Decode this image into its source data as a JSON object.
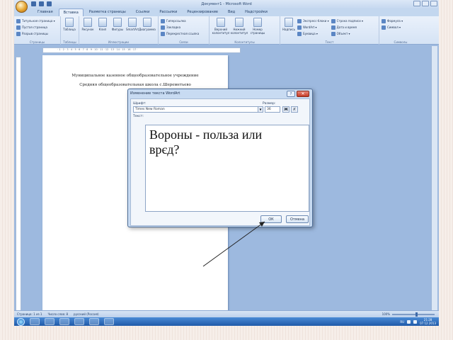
{
  "window": {
    "title": "Документ1 - Microsoft Word"
  },
  "ribbon_tabs": [
    "Главная",
    "Вставка",
    "Разметка страницы",
    "Ссылки",
    "Рассылки",
    "Рецензирование",
    "Вид",
    "Надстройки"
  ],
  "ribbon": {
    "pages_group": {
      "items": [
        "Титульная страница ▾",
        "Пустая страница",
        "Разрыв страницы"
      ],
      "label": "Страницы"
    },
    "tables_group": {
      "button": "Таблица",
      "label": "Таблицы"
    },
    "illustrations_group": {
      "buttons": [
        "Рисунок",
        "Клип",
        "Фигуры",
        "SmartArt",
        "Диаграмма"
      ],
      "label": "Иллюстрации"
    },
    "links_group": {
      "items": [
        "Гиперссылка",
        "Закладка",
        "Перекрестная ссылка"
      ],
      "label": "Связи"
    },
    "header_group": {
      "buttons": [
        "Верхний колонтитул",
        "Нижний колонтитул",
        "Номер страницы"
      ],
      "label": "Колонтитулы"
    },
    "text_group": {
      "button": "Надпись",
      "items": [
        "Экспресс-блоки ▾",
        "WordArt ▾",
        "Буквица ▾",
        "Строка подписи ▾",
        "Дата и время",
        "Объект ▾"
      ],
      "label": "Текст"
    },
    "symbols_group": {
      "items": [
        "Формула ▾",
        "Символ ▾"
      ],
      "label": "Символы"
    }
  },
  "document": {
    "lines": [
      "Муниципальное казенное общеобразовательное учреждение",
      "Средняя общеобразовательная школа с.Шереметьево"
    ]
  },
  "dialog": {
    "title": "Изменение текста WordArt",
    "help": "?",
    "close": "✕",
    "font_label": "Шрифт:",
    "font_value": "Times New Roman",
    "size_label": "Размер:",
    "size_value": "36",
    "bold": "Ж",
    "italic": "К",
    "text_label": "Текст:",
    "text_value": "Вороны - польза или\nврєд?",
    "ok_label": "ОК",
    "cancel_label": "Отмена"
  },
  "statusbar": {
    "page": "Страница: 1 из 1",
    "words": "Число слов: 8",
    "language": "русский (Россия)",
    "zoom": "100%",
    "zoom_value": 55
  },
  "taskbar": {
    "lang": "RU",
    "time": "21:28",
    "date": "07.12.2013"
  },
  "colors": {
    "window_bg": "#9db9df",
    "ribbon": "#eaf1fb",
    "dialog": "#c8dbf2",
    "taskbar": "#2a6fc0"
  }
}
